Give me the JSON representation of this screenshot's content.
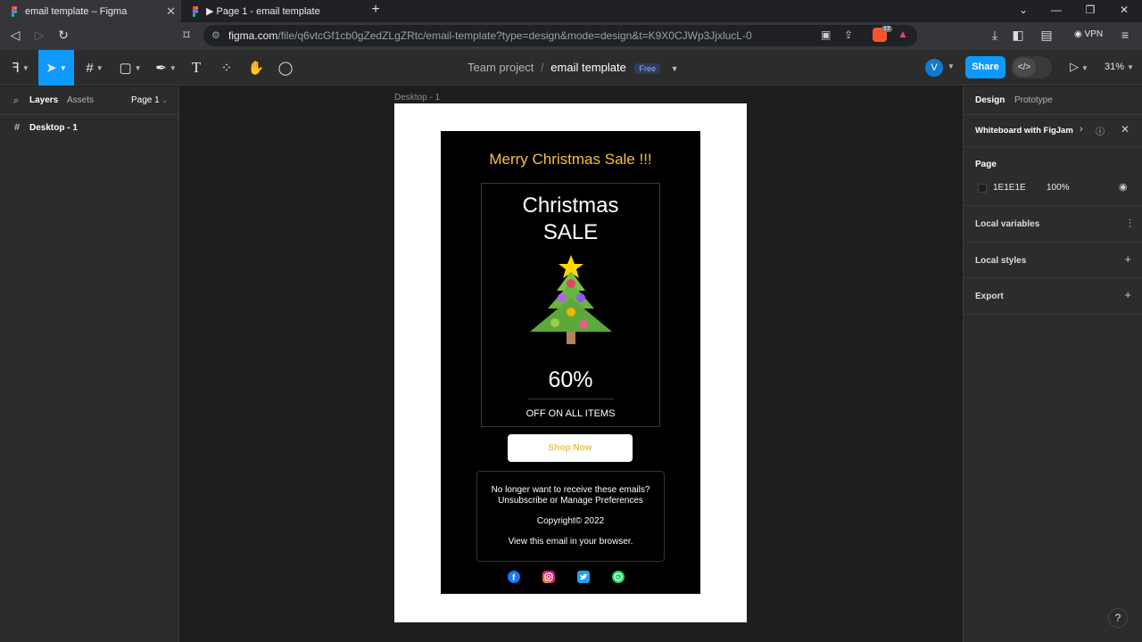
{
  "browser": {
    "tabs": [
      {
        "title": "email template – Figma",
        "active": true
      },
      {
        "title": "▶ Page 1 - email template",
        "active": false
      }
    ],
    "url_host": "figma.com",
    "url_path": "/file/q6vtcGf1cb0gZedZLgZRtc/email-template?type=design&mode=design&t=K9X0CJWp3JjxlucL-0",
    "vpn_label": "VPN",
    "extension_badge": "17"
  },
  "toolbar": {
    "project": "Team project",
    "separator": "/",
    "file_name": "email template",
    "plan_badge": "Free",
    "avatar_letter": "V",
    "share_label": "Share",
    "zoom": "31%"
  },
  "left_panel": {
    "tab_layers": "Layers",
    "tab_assets": "Assets",
    "page_selector": "Page 1",
    "layers": [
      {
        "name": "Desktop - 1"
      }
    ]
  },
  "canvas": {
    "frame_label": "Desktop - 1",
    "email": {
      "heading": "Merry Christmas Sale !!!",
      "promo_title": "Christmas\nSALE",
      "discount": "60%",
      "discount_caption": "OFF ON ALL ITEMS",
      "cta": "Shop Now",
      "footer_line1": "No longer want to receive these emails?",
      "footer_line2": "Unsubscribe or Manage Preferences",
      "copyright": "Copyright© 2022",
      "view_browser": "View this email in your browser.",
      "social_icons": [
        "facebook-icon",
        "instagram-icon",
        "twitter-icon",
        "whatsapp-icon"
      ]
    }
  },
  "right_panel": {
    "tab_design": "Design",
    "tab_prototype": "Prototype",
    "banner": "Whiteboard with FigJam",
    "page_section": "Page",
    "page_color": "1E1E1E",
    "page_opacity": "100%",
    "local_variables": "Local variables",
    "local_styles": "Local styles",
    "export": "Export"
  },
  "colors": {
    "accent": "#0d99ff",
    "email_gold": "#f5c03c",
    "canvas_bg": "#1e1e1e"
  }
}
